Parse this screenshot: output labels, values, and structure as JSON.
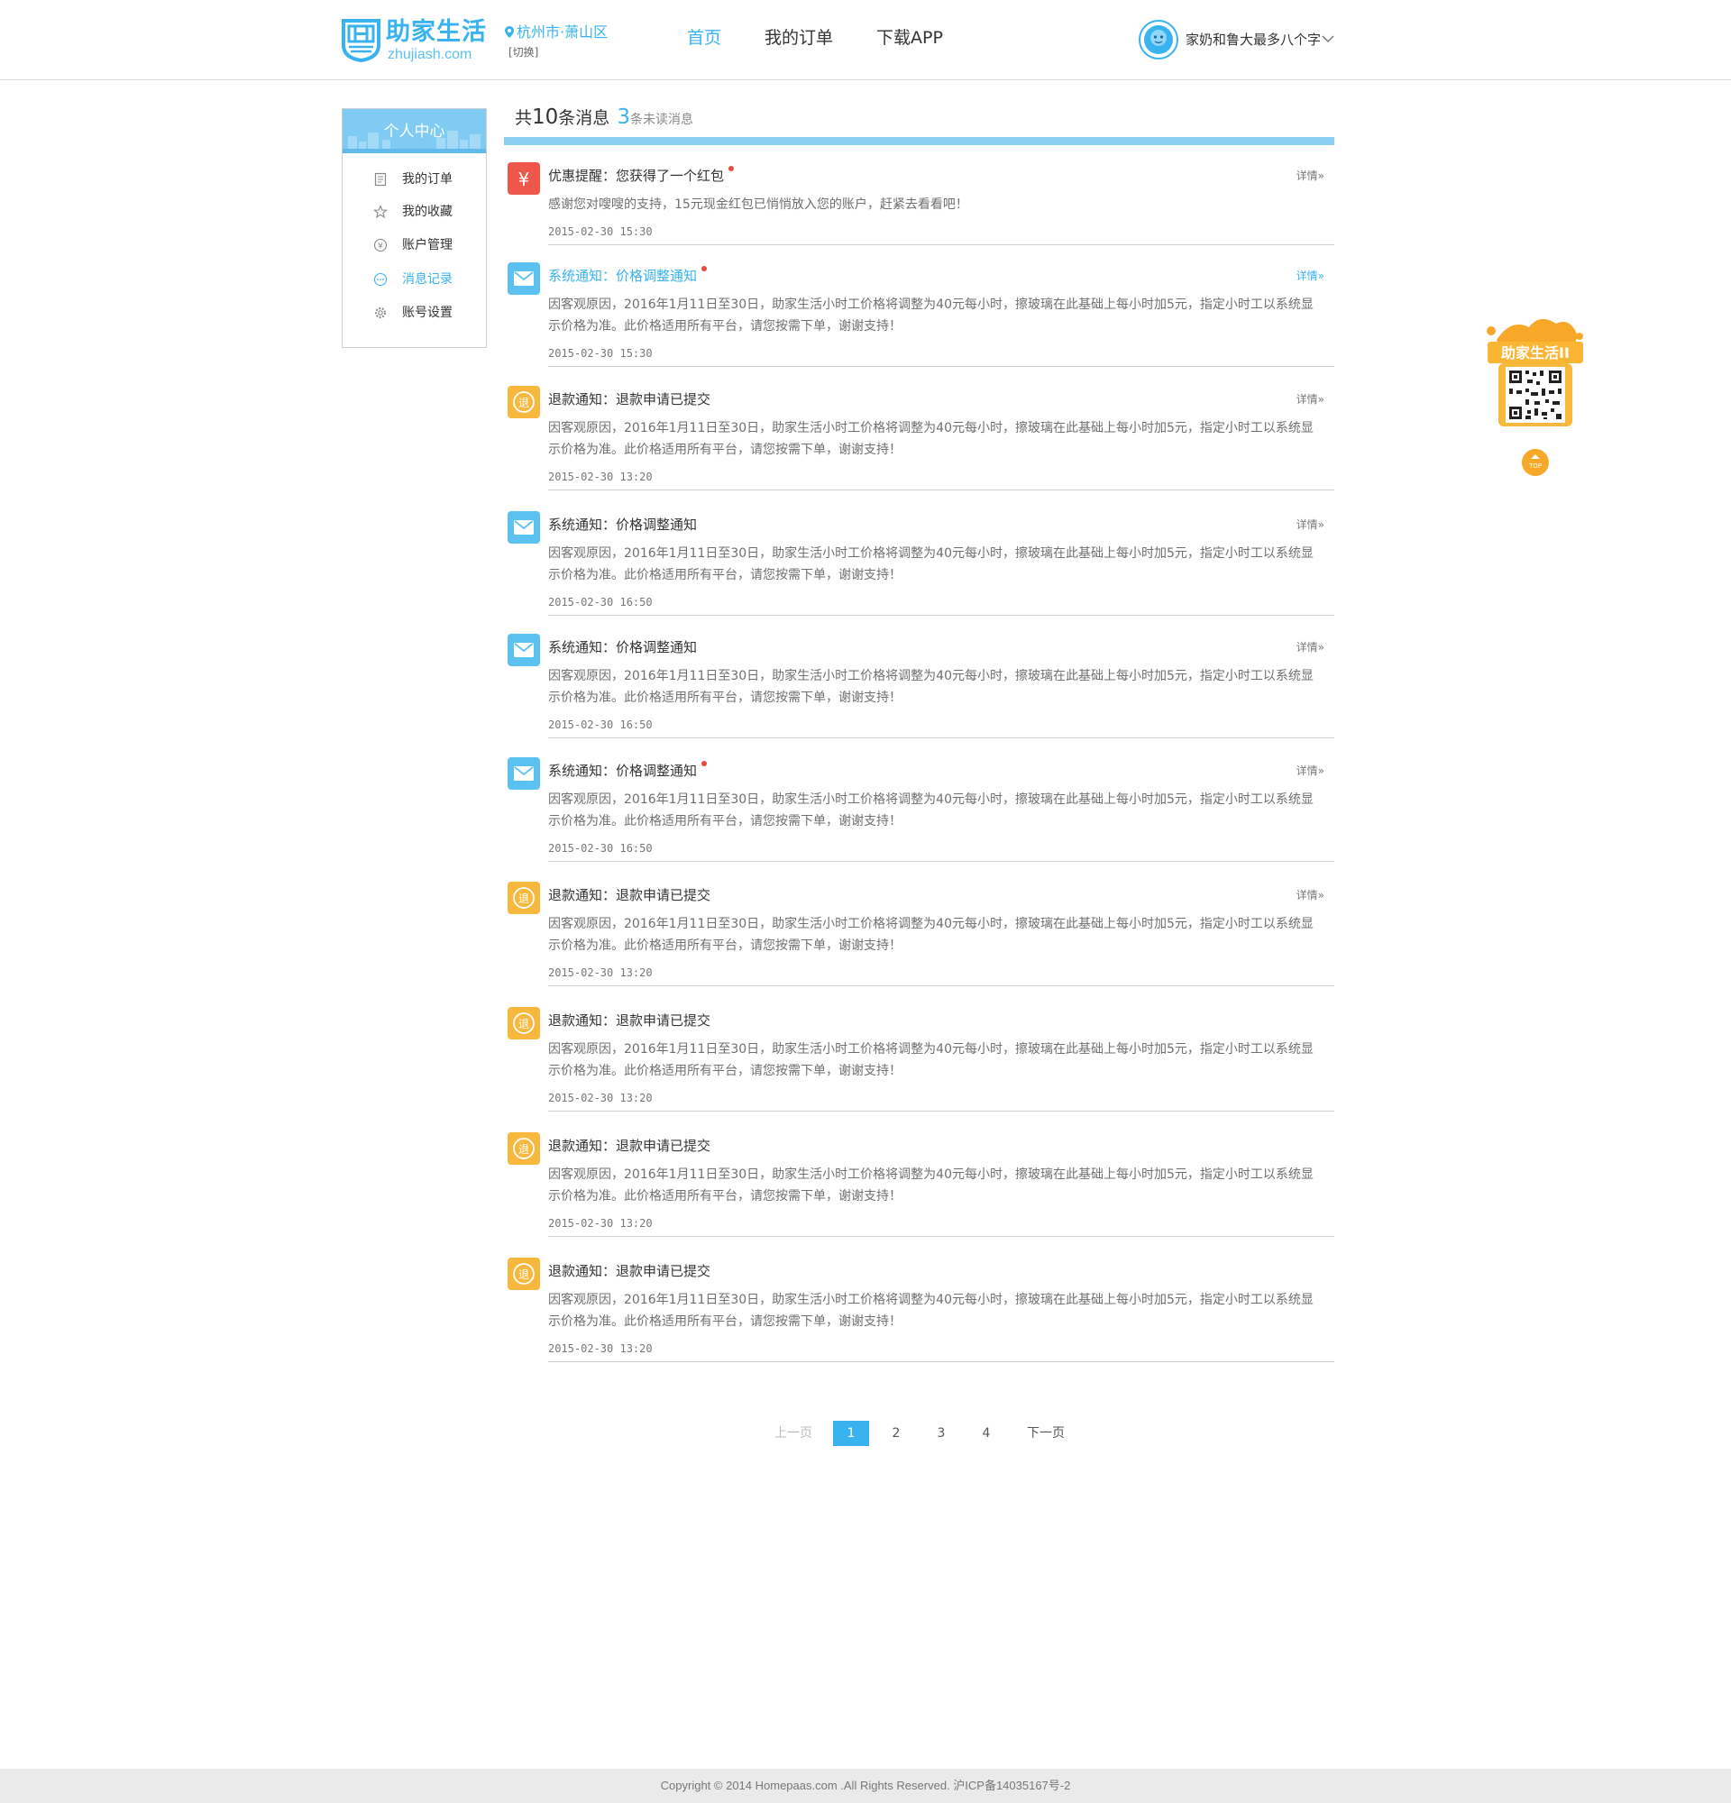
{
  "header": {
    "logo_cn": "助家生活",
    "logo_en": "zhujiash.com",
    "city": "杭州市·萧山区",
    "switch_label": "[切换]",
    "nav": [
      {
        "label": "首页",
        "active": true
      },
      {
        "label": "我的订单",
        "active": false
      },
      {
        "label": "下载APP",
        "active": false
      }
    ],
    "username": "家奶和鲁大最多八个字"
  },
  "sidebar": {
    "title": "个人中心",
    "items": [
      {
        "label": "我的订单",
        "icon": "order-list-icon",
        "active": false
      },
      {
        "label": "我的收藏",
        "icon": "star-icon",
        "active": false
      },
      {
        "label": "账户管理",
        "icon": "account-icon",
        "active": false
      },
      {
        "label": "消息记录",
        "icon": "message-icon",
        "active": true
      },
      {
        "label": "账号设置",
        "icon": "gear-icon",
        "active": false
      }
    ]
  },
  "summary": {
    "total_prefix": "共",
    "total_count": "10",
    "total_suffix": "条消息",
    "unread_count": "3",
    "unread_suffix": "条未读消息"
  },
  "colors": {
    "brand": "#38b3ef",
    "header_bar": "#89d0f4",
    "coupon_icon": "#f0574b",
    "system_icon": "#5bc1f0",
    "refund_icon": "#f8b83e",
    "unread_dot": "#e84a3a"
  },
  "messages": [
    {
      "type": "coupon",
      "icon": "yuan-icon",
      "title": "优惠提醒：您获得了一个红包",
      "unread": true,
      "highlight": false,
      "detail": "详情",
      "body": "感谢您对嗖嗖的支持，15元现金红包已悄悄放入您的账户，赶紧去看看吧！",
      "time": "2015-02-30 15:30"
    },
    {
      "type": "system",
      "icon": "mail-icon",
      "title": "系统通知：价格调整通知",
      "unread": true,
      "highlight": true,
      "detail": "详情",
      "body": "因客观原因，2016年1月11日至30日，助家生活小时工价格将调整为40元每小时，擦玻璃在此基础上每小时加5元，指定小时工以系统显示价格为准。此价格适用所有平台，请您按需下单，谢谢支持！",
      "time": "2015-02-30 15:30"
    },
    {
      "type": "refund",
      "icon": "refund-icon",
      "title": "退款通知：退款申请已提交",
      "unread": false,
      "highlight": false,
      "detail": "详情",
      "body": "因客观原因，2016年1月11日至30日，助家生活小时工价格将调整为40元每小时，擦玻璃在此基础上每小时加5元，指定小时工以系统显示价格为准。此价格适用所有平台，请您按需下单，谢谢支持！",
      "time": "2015-02-30 13:20"
    },
    {
      "type": "system",
      "icon": "mail-icon",
      "title": "系统通知：价格调整通知",
      "unread": false,
      "highlight": false,
      "detail": "详情",
      "body": "因客观原因，2016年1月11日至30日，助家生活小时工价格将调整为40元每小时，擦玻璃在此基础上每小时加5元，指定小时工以系统显示价格为准。此价格适用所有平台，请您按需下单，谢谢支持！",
      "time": "2015-02-30 16:50"
    },
    {
      "type": "system",
      "icon": "mail-icon",
      "title": "系统通知：价格调整通知",
      "unread": false,
      "highlight": false,
      "detail": "详情",
      "body": "因客观原因，2016年1月11日至30日，助家生活小时工价格将调整为40元每小时，擦玻璃在此基础上每小时加5元，指定小时工以系统显示价格为准。此价格适用所有平台，请您按需下单，谢谢支持！",
      "time": "2015-02-30 16:50"
    },
    {
      "type": "system",
      "icon": "mail-icon",
      "title": "系统通知：价格调整通知",
      "unread": true,
      "highlight": false,
      "detail": "详情",
      "body": "因客观原因，2016年1月11日至30日，助家生活小时工价格将调整为40元每小时，擦玻璃在此基础上每小时加5元，指定小时工以系统显示价格为准。此价格适用所有平台，请您按需下单，谢谢支持！",
      "time": "2015-02-30 16:50"
    },
    {
      "type": "refund",
      "icon": "refund-icon",
      "title": "退款通知：退款申请已提交",
      "unread": false,
      "highlight": false,
      "detail": "详情",
      "body": "因客观原因，2016年1月11日至30日，助家生活小时工价格将调整为40元每小时，擦玻璃在此基础上每小时加5元，指定小时工以系统显示价格为准。此价格适用所有平台，请您按需下单，谢谢支持！",
      "time": "2015-02-30 13:20"
    },
    {
      "type": "refund",
      "icon": "refund-icon",
      "title": "退款通知：退款申请已提交",
      "unread": false,
      "highlight": false,
      "detail": "",
      "body": "因客观原因，2016年1月11日至30日，助家生活小时工价格将调整为40元每小时，擦玻璃在此基础上每小时加5元，指定小时工以系统显示价格为准。此价格适用所有平台，请您按需下单，谢谢支持！",
      "time": "2015-02-30 13:20"
    },
    {
      "type": "refund",
      "icon": "refund-icon",
      "title": "退款通知：退款申请已提交",
      "unread": false,
      "highlight": false,
      "detail": "",
      "body": "因客观原因，2016年1月11日至30日，助家生活小时工价格将调整为40元每小时，擦玻璃在此基础上每小时加5元，指定小时工以系统显示价格为准。此价格适用所有平台，请您按需下单，谢谢支持！",
      "time": "2015-02-30 13:20"
    },
    {
      "type": "refund",
      "icon": "refund-icon",
      "title": "退款通知：退款申请已提交",
      "unread": false,
      "highlight": false,
      "detail": "",
      "body": "因客观原因，2016年1月11日至30日，助家生活小时工价格将调整为40元每小时，擦玻璃在此基础上每小时加5元，指定小时工以系统显示价格为准。此价格适用所有平台，请您按需下单，谢谢支持！",
      "time": "2015-02-30 13:20"
    }
  ],
  "pagination": {
    "prev": "上一页",
    "pages": [
      "1",
      "2",
      "3",
      "4"
    ],
    "current": "1",
    "next": "下一页"
  },
  "float_badge": {
    "label": "助家生活II",
    "top_label": "TOP"
  },
  "footer": {
    "copyright": "Copyright © 2014 Homepaas.com .All Rights Reserved. 沪ICP备14035167号-2"
  }
}
